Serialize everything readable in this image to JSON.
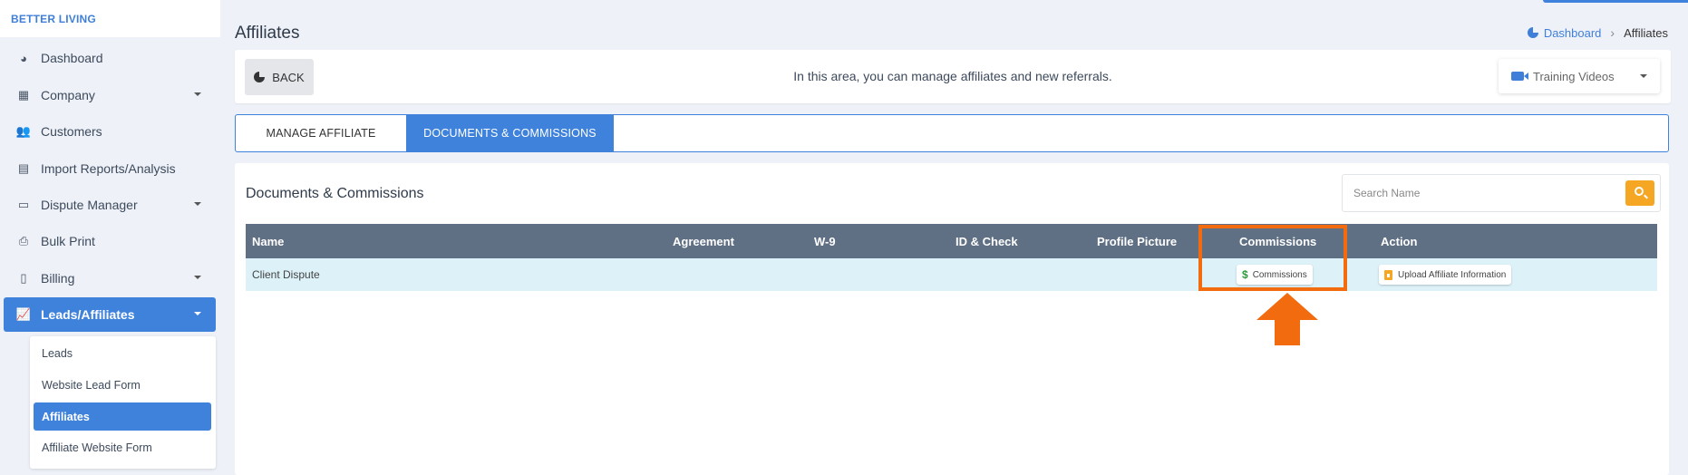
{
  "sidebar": {
    "brand": "BETTER LIVING",
    "items": [
      {
        "label": "Dashboard",
        "icon": "pie-chart-icon"
      },
      {
        "label": "Company",
        "icon": "building-icon"
      },
      {
        "label": "Customers",
        "icon": "users-icon"
      },
      {
        "label": "Import Reports/Analysis",
        "icon": "file-import-icon"
      },
      {
        "label": "Dispute Manager",
        "icon": "laptop-icon"
      },
      {
        "label": "Bulk Print",
        "icon": "printer-icon"
      },
      {
        "label": "Billing",
        "icon": "invoice-icon"
      },
      {
        "label": "Leads/Affiliates",
        "icon": "chart-line-icon"
      }
    ],
    "submenu": [
      {
        "label": "Leads"
      },
      {
        "label": "Website Lead Form"
      },
      {
        "label": "Affiliates"
      },
      {
        "label": "Affiliate Website Form"
      }
    ]
  },
  "header": {
    "title": "Affiliates",
    "breadcrumb": {
      "home": "Dashboard",
      "current": "Affiliates"
    }
  },
  "info_bar": {
    "back_label": "BACK",
    "message": "In this area, you can manage affiliates and new referrals.",
    "training_label": "Training Videos"
  },
  "tabs": [
    {
      "label": "MANAGE AFFILIATE"
    },
    {
      "label": "DOCUMENTS & COMMISSIONS"
    }
  ],
  "card": {
    "title": "Documents & Commissions",
    "search_placeholder": "Search Name"
  },
  "table": {
    "columns": [
      "Name",
      "Agreement",
      "W-9",
      "ID & Check",
      "Profile Picture",
      "Commissions",
      "Action"
    ],
    "rows": [
      {
        "name": "Client Dispute",
        "agreement": "",
        "w9": "",
        "id_check": "",
        "profile_picture": "",
        "commissions_button": "Commissions",
        "action_button": "Upload Affiliate Information"
      }
    ]
  },
  "colors": {
    "accent": "#3f82dc",
    "highlight": "#f26b0f",
    "search_button": "#f5a623",
    "table_header": "#5f6f84",
    "row_bg": "#dcf1f8"
  }
}
